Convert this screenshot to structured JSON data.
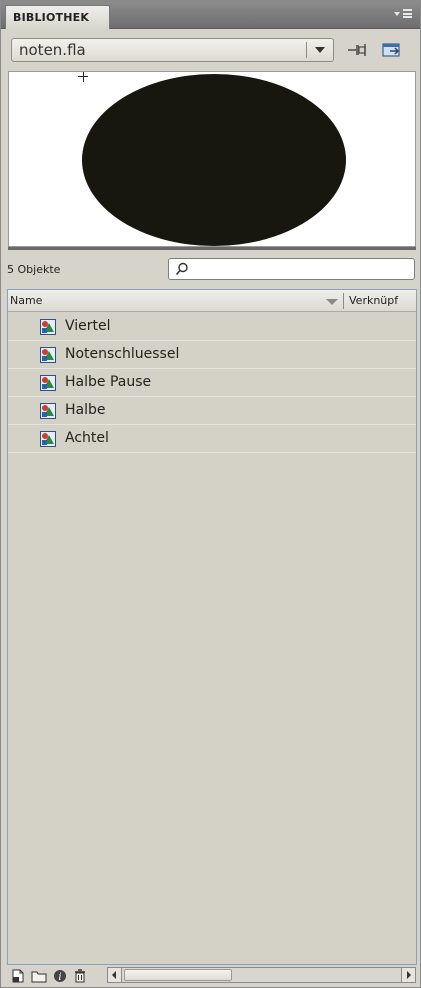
{
  "panel": {
    "tab_label": "BIBLIOTHEK"
  },
  "document": {
    "selected": "noten.fla"
  },
  "preview": {
    "shape_color": "#17170f"
  },
  "library": {
    "count_label": "5 Objekte",
    "search_value": "",
    "columns": {
      "name": "Name",
      "linkage": "Verknüpf"
    },
    "items": [
      {
        "label": "Viertel",
        "icon": "movieclip-symbol-icon"
      },
      {
        "label": "Notenschluessel",
        "icon": "movieclip-symbol-icon"
      },
      {
        "label": "Halbe Pause",
        "icon": "movieclip-symbol-icon"
      },
      {
        "label": "Halbe",
        "icon": "movieclip-symbol-icon"
      },
      {
        "label": "Achtel",
        "icon": "movieclip-symbol-icon"
      }
    ]
  },
  "toolbar": {
    "buttons": [
      "new-symbol-icon",
      "new-folder-icon",
      "properties-icon",
      "delete-icon"
    ]
  }
}
